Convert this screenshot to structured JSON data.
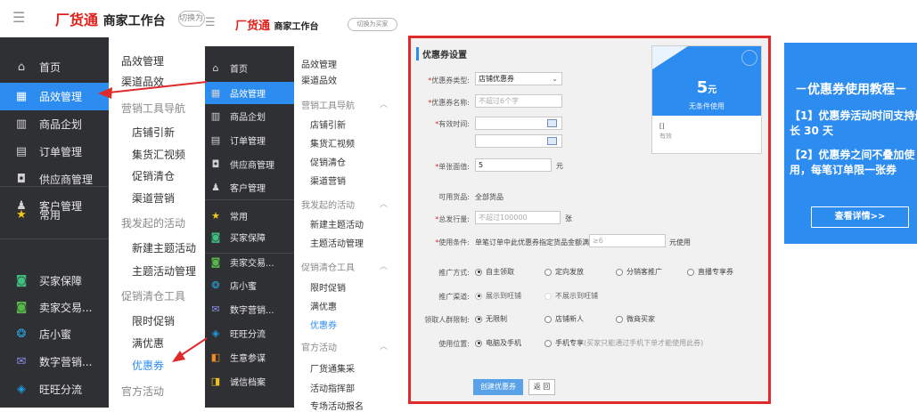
{
  "left_panel": {
    "logo_brand": "厂货通",
    "logo_text": "商家工作台",
    "switch_label": "切换为买家",
    "nav": [
      {
        "label": "首页",
        "icon": "home-icon",
        "glyph": "⌂"
      },
      {
        "label": "品效管理",
        "icon": "grid-icon",
        "glyph": "▦",
        "active": true
      },
      {
        "label": "商品企划",
        "icon": "calendar-icon",
        "glyph": "▥"
      },
      {
        "label": "订单管理",
        "icon": "document-icon",
        "glyph": "▤"
      },
      {
        "label": "供应商管理",
        "icon": "monitor-icon",
        "glyph": "◘"
      },
      {
        "label": "客户管理",
        "icon": "user-icon",
        "glyph": "♟"
      },
      {
        "label": "常用",
        "icon": "star-icon",
        "glyph": "★"
      },
      {
        "label": "买家保障",
        "icon": "shield-icon",
        "glyph": "◙"
      },
      {
        "label": "卖家交易...",
        "icon": "chat-icon",
        "glyph": "◙"
      },
      {
        "label": "店小蜜",
        "icon": "bee-icon",
        "glyph": "❂"
      },
      {
        "label": "数字营销...",
        "icon": "mail-icon",
        "glyph": "✉"
      },
      {
        "label": "旺旺分流",
        "icon": "share-icon",
        "glyph": "◈"
      }
    ],
    "sub": [
      "品效管理",
      "渠道品效",
      "营销工具导航",
      "店铺引新",
      "集货汇视频",
      "促销清仓",
      "渠道营销",
      "我发起的活动",
      "新建主题活动",
      "主题活动管理",
      "促销清仓工具",
      "限时促销",
      "满优惠",
      "优惠券",
      "官方活动"
    ]
  },
  "middle_panel": {
    "logo_brand": "厂货通",
    "logo_text": "商家工作台",
    "switch_label": "切换为买家",
    "nav": [
      {
        "label": "首页",
        "glyph": "⌂"
      },
      {
        "label": "品效管理",
        "glyph": "▦",
        "active": true
      },
      {
        "label": "商品企划",
        "glyph": "▥"
      },
      {
        "label": "订单管理",
        "glyph": "▤"
      },
      {
        "label": "供应商管理",
        "glyph": "◘"
      },
      {
        "label": "客户管理",
        "glyph": "♟"
      },
      {
        "label": "常用",
        "glyph": "★"
      },
      {
        "label": "买家保障",
        "glyph": "◙"
      },
      {
        "label": "卖家交易...",
        "glyph": "◙"
      },
      {
        "label": "店小蜜",
        "glyph": "❂"
      },
      {
        "label": "数字营销...",
        "glyph": "✉"
      },
      {
        "label": "旺旺分流",
        "glyph": "◈"
      },
      {
        "label": "生意参谋",
        "glyph": "◧"
      },
      {
        "label": "诚信档案",
        "glyph": "◨"
      }
    ],
    "sub": [
      "品效管理",
      "渠道品效",
      "营销工具导航",
      "店铺引新",
      "集货汇视频",
      "促销清仓",
      "渠道营销",
      "我发起的活动",
      "新建主题活动",
      "主题活动管理",
      "促销清仓工具",
      "限时促销",
      "满优惠",
      "优惠券",
      "官方活动",
      "厂货通集采",
      "活动指挥部",
      "专场活动报名"
    ]
  },
  "form": {
    "title": "优惠券设置",
    "coupon_type_label": "*优惠券类型:",
    "coupon_type_value": "店铺优惠券",
    "coupon_name_label": "*优惠券名称:",
    "coupon_name_placeholder": "不超过6个字",
    "valid_time_label": "*有效时间:",
    "face_value_label": "*单张面值:",
    "face_value_value": "5",
    "face_value_unit": "元",
    "goods_label": "可用货品:",
    "goods_value": "全部货品",
    "total_label": "*总发行量:",
    "total_placeholder": "不超过100000",
    "total_unit": "张",
    "usage_label": "*使用条件:",
    "usage_text": "单笔订单中此优惠券指定货品金额满",
    "usage_input": "≥6",
    "usage_unit": "元使用",
    "promo_method_label": "推广方式:",
    "promo_methods": [
      "自主领取",
      "定向发放",
      "分销客推广",
      "直播专享券"
    ],
    "promo_channel_label": "推广渠道:",
    "promo_channels": [
      "展示到旺铺",
      "不展示到旺铺"
    ],
    "crowd_label": "领取人群限制:",
    "crowds": [
      "无限制",
      "店铺新人",
      "微商买家"
    ],
    "position_label": "使用位置:",
    "positions": [
      "电脑及手机",
      "手机专享"
    ],
    "position_note": "(买家只能通过手机下单才能使用此券)",
    "create_button": "创建优惠券",
    "back_button": "返 回",
    "preview": {
      "amount": "5",
      "currency": "元",
      "condition": "无条件使用",
      "name_placeholder": "[]",
      "validity": "有效"
    }
  },
  "banner": {
    "title": "－优惠券使用教程－",
    "tips": [
      "【1】优惠券活动时间支持最长 30 天",
      "【2】优惠券之间不叠加使用，每笔订单限一张券"
    ],
    "more_button": "查看详情>>"
  },
  "colors": {
    "accent": "#2d8cf0",
    "sidebar": "#2f3033",
    "highlight_border": "#e02a2a"
  }
}
